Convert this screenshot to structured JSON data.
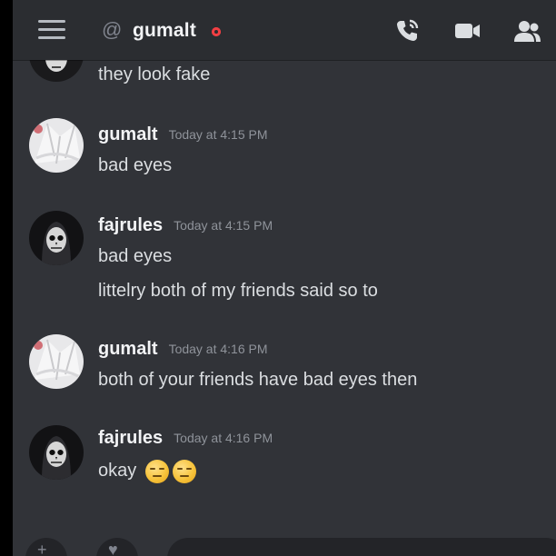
{
  "header": {
    "channel_name": "gumalt",
    "menu_icon": "hamburger-icon",
    "dm_icon": "at-icon",
    "status_color": "#f23f43",
    "actions": [
      "phone-call-icon",
      "video-camera-icon",
      "members-icon"
    ]
  },
  "messages": [
    {
      "continued": true,
      "lines": [
        "they look fake"
      ]
    },
    {
      "author": "gumalt",
      "time": "Today at 4:15 PM",
      "lines": [
        "bad eyes"
      ]
    },
    {
      "author": "fajrules",
      "time": "Today at 4:15 PM",
      "lines": [
        "bad eyes",
        "littelry both of my friends said so to"
      ]
    },
    {
      "author": "gumalt",
      "time": "Today at 4:16 PM",
      "lines": [
        "both of your friends have bad eyes then"
      ]
    },
    {
      "author": "fajrules",
      "time": "Today at 4:16 PM",
      "lines": [
        "okay"
      ],
      "emoji": [
        "unamused-face-emoji",
        "unamused-face-emoji"
      ]
    }
  ],
  "colors": {
    "background": "#313338",
    "header": "#2b2d31",
    "text": "#dbdee1",
    "username": "#f2f3f5",
    "timestamp": "#8f939a"
  }
}
